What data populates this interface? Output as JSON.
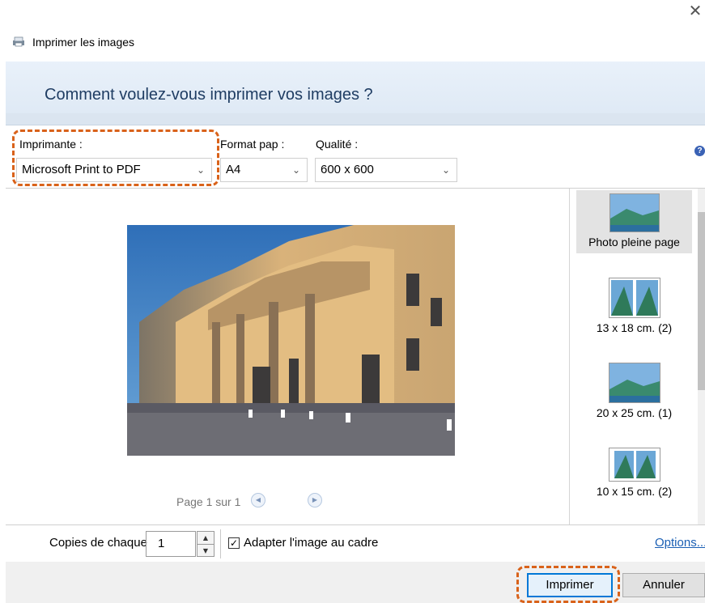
{
  "window": {
    "title": "Imprimer les images",
    "close_icon": "close-icon"
  },
  "header": {
    "question": "Comment voulez-vous imprimer vos images ?"
  },
  "settings": {
    "printer_label": "Imprimante :",
    "printer_value": "Microsoft Print to PDF",
    "paper_label": "Format pap :",
    "paper_value": "A4",
    "quality_label": "Qualité :",
    "quality_value": "600 x 600",
    "help_glyph": "?"
  },
  "preview": {
    "page_text": "Page 1 sur 1",
    "prev_glyph": "◀",
    "next_glyph": "▶"
  },
  "layouts": [
    {
      "label": "Photo pleine page",
      "selected": true
    },
    {
      "label": "13 x 18 cm. (2)",
      "selected": false
    },
    {
      "label": "20 x 25 cm. (1)",
      "selected": false
    },
    {
      "label": "10 x 15 cm. (2)",
      "selected": false
    }
  ],
  "options_bar": {
    "copies_label": "Copies de chaque",
    "copies_value": "1",
    "fit_label": "Adapter l'image au cadre",
    "fit_checked": true,
    "options_link": "Options..."
  },
  "footer": {
    "print_button": "Imprimer",
    "cancel_button": "Annuler"
  },
  "colors": {
    "accent_highlight": "#d9621a",
    "header_text": "#1f3d63",
    "link": "#1a5fb4",
    "primary_border": "#0078d7"
  }
}
